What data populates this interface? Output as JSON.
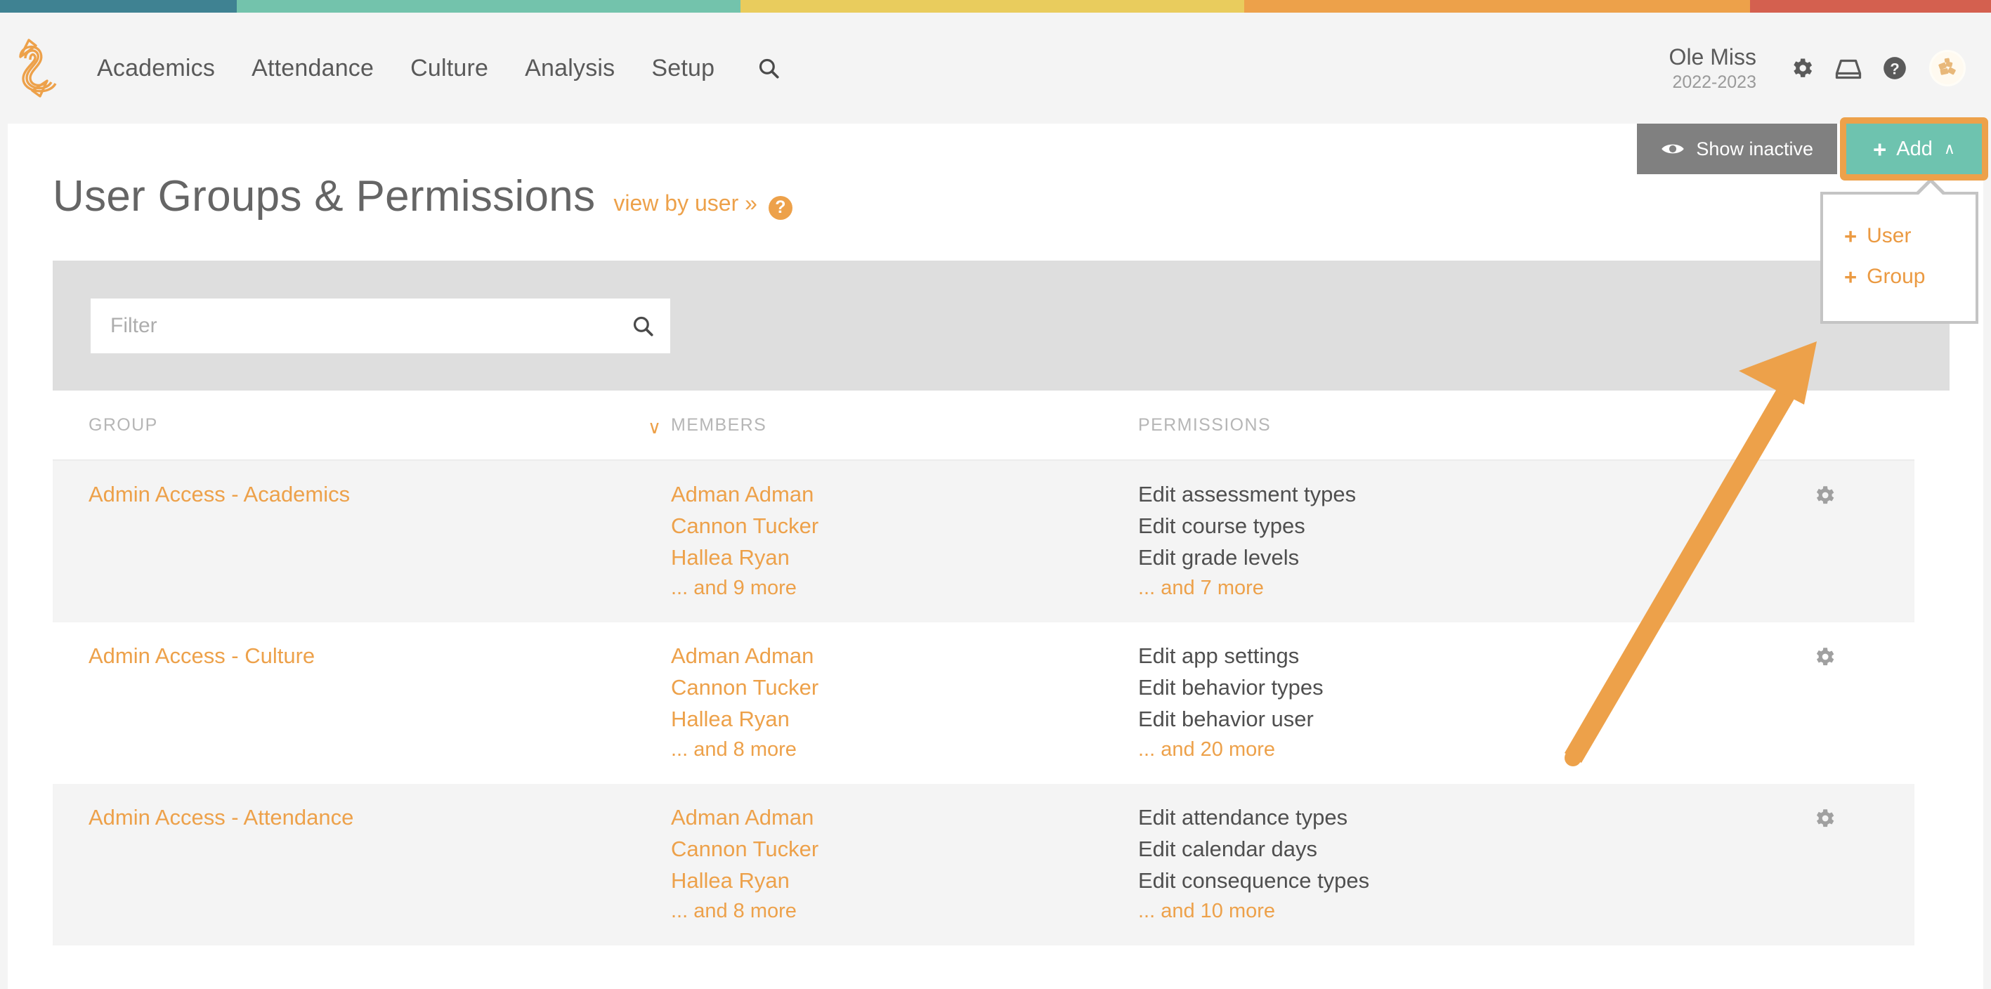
{
  "top_strip": {
    "segments": [
      {
        "name": "teal",
        "color": "#3f8292",
        "width_pct": 11.9
      },
      {
        "name": "green",
        "color": "#73c3ac",
        "width_pct": 25.3
      },
      {
        "name": "yellow",
        "color": "#e9cc5d",
        "width_pct": 25.3
      },
      {
        "name": "orange",
        "color": "#eda14a",
        "width_pct": 25.4
      },
      {
        "name": "red",
        "color": "#d4604f",
        "width_pct": 12.1
      }
    ]
  },
  "header": {
    "logo_name": "swirl-pencil-logo",
    "nav_items": [
      {
        "label": "Academics"
      },
      {
        "label": "Attendance"
      },
      {
        "label": "Culture"
      },
      {
        "label": "Analysis"
      },
      {
        "label": "Setup"
      }
    ],
    "search_icon": "search-icon",
    "org_name": "Ole Miss",
    "school_year": "2022-2023",
    "icons": [
      {
        "name": "gear-icon"
      },
      {
        "name": "inbox-icon"
      },
      {
        "name": "help-icon"
      }
    ],
    "avatar_name": "user-avatar"
  },
  "actions": {
    "show_inactive_label": "Show inactive",
    "show_inactive_icon": "eye-icon",
    "add_label": "Add",
    "add_plus": "+",
    "add_caret": "∧",
    "dropdown_items": [
      {
        "plus": "+",
        "label": "User"
      },
      {
        "plus": "+",
        "label": "Group"
      }
    ]
  },
  "page": {
    "title": "User Groups & Permissions",
    "view_by_user_link": "view by user »",
    "help_glyph": "?"
  },
  "filter": {
    "placeholder": "Filter",
    "value": "",
    "search_icon": "search-icon"
  },
  "table": {
    "headers": {
      "group": "GROUP",
      "members": "MEMBERS",
      "permissions": "PERMISSIONS"
    },
    "sort_caret": "∨",
    "rows": [
      {
        "group": "Admin Access - Academics",
        "members": [
          "Adman Adman",
          "Cannon Tucker",
          "Hallea Ryan"
        ],
        "members_more": "... and 9 more",
        "permissions": [
          "Edit assessment types",
          "Edit course types",
          "Edit grade levels"
        ],
        "permissions_more": "... and 7 more",
        "gear": "gear-icon"
      },
      {
        "group": "Admin Access - Culture",
        "members": [
          "Adman Adman",
          "Cannon Tucker",
          "Hallea Ryan"
        ],
        "members_more": "... and 8 more",
        "permissions": [
          "Edit app settings",
          "Edit behavior types",
          "Edit behavior user"
        ],
        "permissions_more": "... and 20 more",
        "gear": "gear-icon"
      },
      {
        "group": "Admin Access - Attendance",
        "members": [
          "Adman Adman",
          "Cannon Tucker",
          "Hallea Ryan"
        ],
        "members_more": "... and 8 more",
        "permissions": [
          "Edit attendance types",
          "Edit calendar days",
          "Edit consequence types"
        ],
        "permissions_more": "... and 10 more",
        "gear": "gear-icon"
      }
    ]
  },
  "annotation": {
    "arrow_name": "annotation-arrow-to-add-button",
    "arrow_color": "#eda14a",
    "highlight_color": "#eda14a"
  },
  "colors": {
    "accent_orange": "#eda14a",
    "accent_teal": "#6ec3af",
    "text_gray": "#595959",
    "muted_gray": "#b6b6b6",
    "filter_bar": "#dedede",
    "row_alt": "#f4f4f4"
  }
}
